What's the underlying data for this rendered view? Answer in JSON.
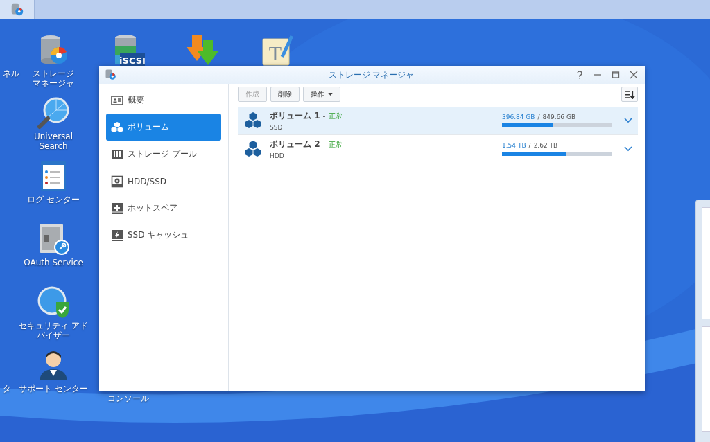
{
  "taskbar": {
    "apps": [
      {
        "kind": "storage",
        "selected": true
      }
    ]
  },
  "desktop": {
    "icons": [
      {
        "label": "ネル",
        "kind": "none"
      },
      {
        "label": "タ",
        "kind": "none"
      },
      {
        "label": "ストレージマネージャ",
        "kind": "storage"
      },
      {
        "label": "Universal Search",
        "kind": "search"
      },
      {
        "label": "ログ センター",
        "kind": "log"
      },
      {
        "label": "OAuth Service",
        "kind": "oauth"
      },
      {
        "label": "セキュリティ アドバイザー",
        "kind": "security"
      },
      {
        "label": "サポート センター",
        "kind": "support"
      },
      {
        "kind": "iscsi",
        "badge": "iSCSI"
      },
      {
        "label": "コンソール",
        "kind": "none"
      },
      {
        "kind": "download"
      },
      {
        "kind": "editor",
        "glyph": "T"
      }
    ]
  },
  "window": {
    "title": "ストレージ マネージャ",
    "sidebar": {
      "items": [
        {
          "label": "概要",
          "kind": "overview",
          "selected": false
        },
        {
          "label": "ボリューム",
          "kind": "volume",
          "selected": true
        },
        {
          "label": "ストレージ プール",
          "kind": "pool",
          "selected": false
        },
        {
          "label": "HDD/SSD",
          "kind": "disk",
          "selected": false
        },
        {
          "label": "ホットスペア",
          "kind": "spare",
          "selected": false
        },
        {
          "label": "SSD キャッシュ",
          "kind": "cache",
          "selected": false
        }
      ]
    },
    "toolbar": {
      "buttons": [
        {
          "label": "作成",
          "disabled": true,
          "dropdown": false
        },
        {
          "label": "削除",
          "disabled": false,
          "dropdown": false
        },
        {
          "label": "操作",
          "disabled": false,
          "dropdown": true
        }
      ]
    },
    "volumes": [
      {
        "name": "ボリューム 1",
        "separator": "-",
        "status": "正常",
        "divider": "/",
        "type": "SSD",
        "used": "396.84 GB",
        "total": "849.66 GB",
        "level": 0.46,
        "selected": true
      },
      {
        "name": "ボリューム 2",
        "separator": "-",
        "status": "正常",
        "divider": "/",
        "type": "HDD",
        "used": "1.54 TB",
        "total": "2.62 TB",
        "level": 0.59,
        "selected": false
      }
    ]
  }
}
